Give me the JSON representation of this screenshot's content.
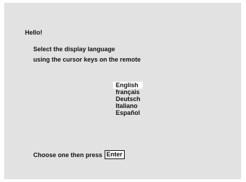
{
  "screen": {
    "greeting": "Hello!",
    "instructions": [
      "Select the display language",
      "using the cursor keys on the remote"
    ],
    "languages": [
      {
        "label": "English",
        "selected": true
      },
      {
        "label": "français",
        "selected": false
      },
      {
        "label": "Deutsch",
        "selected": false
      },
      {
        "label": "Italiano",
        "selected": false
      },
      {
        "label": "Español",
        "selected": false
      }
    ],
    "footer_prompt": "Choose one then press",
    "enter_key_label": "Enter"
  },
  "colors": {
    "screen_background": "#e2e2e2",
    "selection_highlight": "#ffffff",
    "text": "#111111"
  }
}
